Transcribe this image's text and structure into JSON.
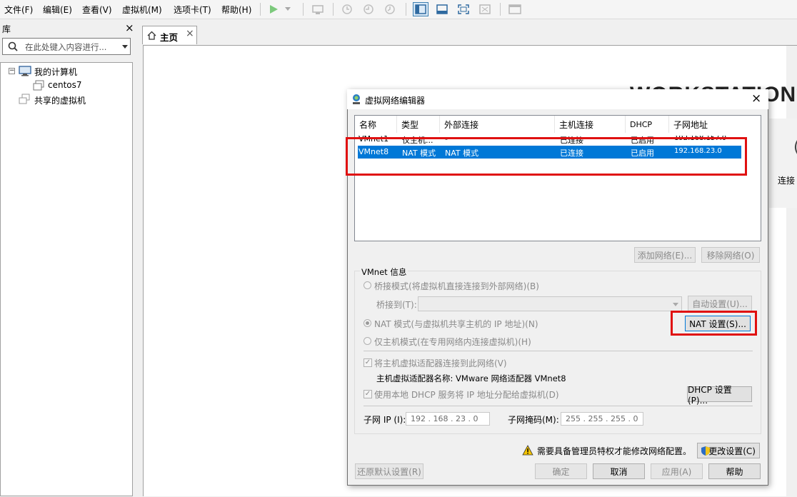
{
  "menu": [
    "文件(F)",
    "编辑(E)",
    "查看(V)",
    "虚拟机(M)",
    "选项卡(T)",
    "帮助(H)"
  ],
  "library": {
    "title": "库",
    "search_placeholder": "在此处键入内容进行...",
    "tree": {
      "my_computer": "我的计算机",
      "vm": "centos7",
      "shared": "共享的虚拟机"
    }
  },
  "tabs": {
    "home": "主页"
  },
  "main": {
    "logo": "WORKSTATION",
    "logo_tm": "™",
    "side_text": "连接"
  },
  "dialog": {
    "title": "虚拟网络编辑器",
    "columns": [
      "名称",
      "类型",
      "外部连接",
      "主机连接",
      "DHCP",
      "子网地址"
    ],
    "rows": [
      {
        "name": "VMnet1",
        "type": "仅主机...",
        "external": "-",
        "host": "已连接",
        "dhcp": "已启用",
        "subnet": "192.168.157.0"
      },
      {
        "name": "VMnet8",
        "type": "NAT 模式",
        "external": "NAT 模式",
        "host": "已连接",
        "dhcp": "已启用",
        "subnet": "192.168.23.0"
      }
    ],
    "add_network": "添加网络(E)...",
    "remove_network": "移除网络(O)",
    "group_title": "VMnet 信息",
    "bridge_mode": "桥接模式(将虚拟机直接连接到外部网络)(B)",
    "bridge_to": "桥接到(T):",
    "auto_settings": "自动设置(U)...",
    "nat_mode": "NAT 模式(与虚拟机共享主机的 IP 地址)(N)",
    "nat_settings": "NAT 设置(S)...",
    "host_only": "仅主机模式(在专用网络内连接虚拟机)(H)",
    "connect_adapter": "将主机虚拟适配器连接到此网络(V)",
    "adapter_name": "主机虚拟适配器名称: VMware 网络适配器 VMnet8",
    "use_dhcp": "使用本地 DHCP 服务将 IP 地址分配给虚拟机(D)",
    "dhcp_settings": "DHCP 设置(P)...",
    "subnet_ip_label": "子网 IP (I):",
    "subnet_ip": "192 . 168 .  23  .  0",
    "subnet_mask_label": "子网掩码(M):",
    "subnet_mask": "255 . 255 . 255 .  0",
    "admin_warning": "需要具备管理员特权才能修改网络配置。",
    "change_settings": "更改设置(C)",
    "restore_defaults": "还原默认设置(R)",
    "ok": "确定",
    "cancel": "取消",
    "apply": "应用(A)",
    "help": "帮助"
  },
  "colors": {
    "selection": "#0078d7",
    "highlight_box": "#e01010",
    "accent_green": "#4caf50"
  }
}
